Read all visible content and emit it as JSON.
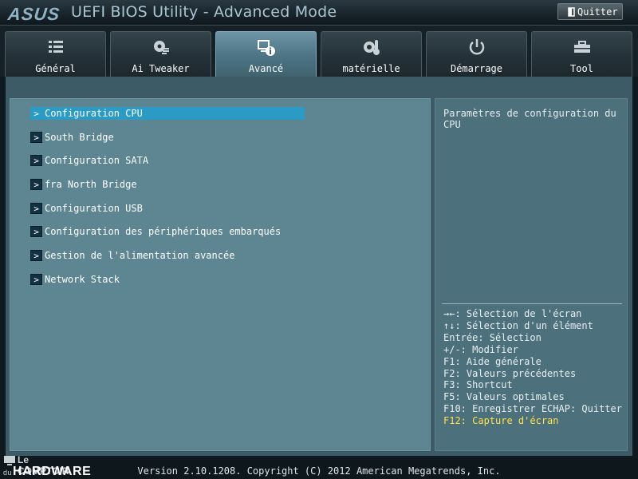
{
  "header": {
    "logo": "ASUS",
    "title": "UEFI BIOS Utility - Advanced Mode",
    "quit_label": "Quitter"
  },
  "tabs": [
    {
      "label": "Général",
      "icon": "list-icon"
    },
    {
      "label": "Ai Tweaker",
      "icon": "fan-icon"
    },
    {
      "label": "Avancé",
      "icon": "info-monitor-icon"
    },
    {
      "label": "matérielle",
      "icon": "thermometer-gear-icon"
    },
    {
      "label": "Démarrage",
      "icon": "power-icon"
    },
    {
      "label": "Tool",
      "icon": "toolbox-icon"
    }
  ],
  "active_tab": "Avancé",
  "menu": {
    "items": [
      {
        "label": "Configuration CPU",
        "arrow": ">",
        "selected": true
      },
      {
        "label": "South Bridge",
        "arrow": ">"
      },
      {
        "label": "Configuration SATA",
        "arrow": ">"
      },
      {
        "label": "fra North Bridge",
        "arrow": ">"
      },
      {
        "label": "Configuration USB",
        "arrow": ">"
      },
      {
        "label": "Configuration des périphériques embarqués",
        "arrow": ">"
      },
      {
        "label": "Gestion de l'alimentation avancée",
        "arrow": ">"
      },
      {
        "label": "Network Stack",
        "arrow": ">"
      }
    ]
  },
  "help": {
    "description": "Paramètres de configuration du CPU",
    "hotkeys": [
      "→←: Sélection de l'écran",
      "↑↓: Sélection d'un élément",
      "Entrée: Sélection",
      "+/-: Modifier",
      "F1: Aide générale",
      "F2: Valeurs précédentes",
      "F3: Shortcut",
      "F5: Valeurs optimales",
      "F10: Enregistrer  ECHAP: Quitter",
      "F12: Capture d'écran"
    ]
  },
  "footer": {
    "version": "Version 2.10.1208. Copyright (C) 2012 American Megatrends, Inc."
  },
  "watermark": {
    "line1": "Le COMPTOIR",
    "prefix": "du",
    "line2": "HARDWARE"
  },
  "colors": {
    "selected_item": "#2b9ac4",
    "highlight_text": "#ffe04a",
    "panel_left": "#5d8592",
    "panel_right": "#4d717c"
  }
}
